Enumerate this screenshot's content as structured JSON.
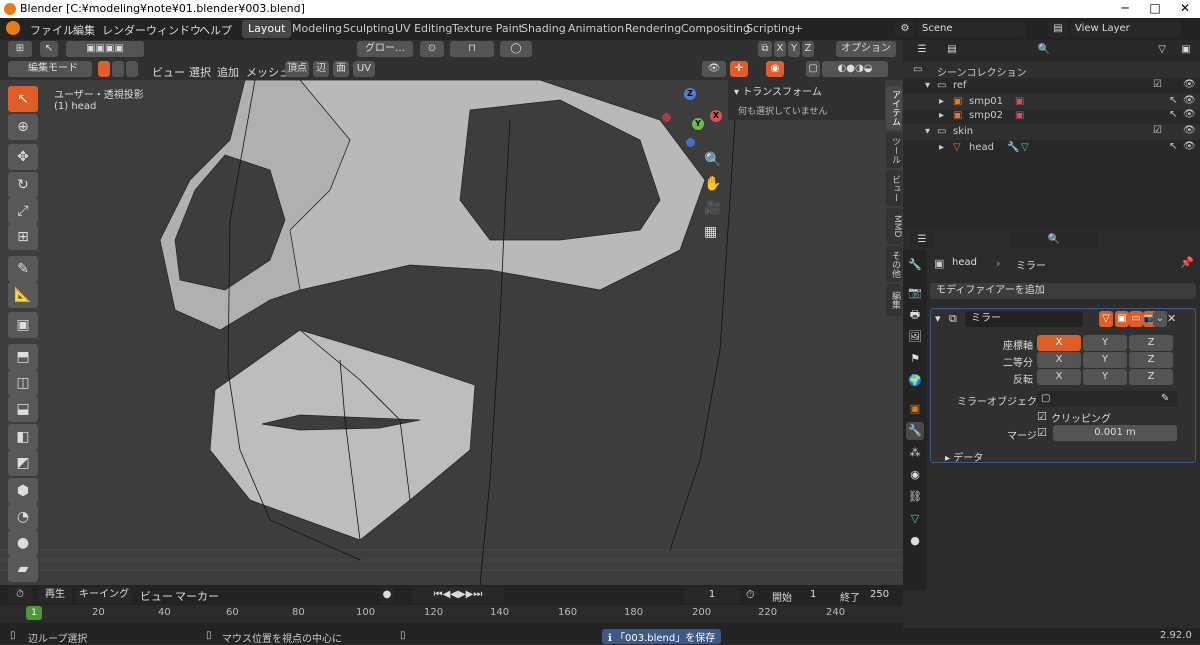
{
  "window": {
    "title": "Blender [C:¥modeling¥note¥01.blender¥003.blend]",
    "min": "─",
    "max": "□",
    "close": "✕"
  },
  "menu": [
    "ファイル",
    "編集",
    "レンダー",
    "ウィンドウ",
    "ヘルプ"
  ],
  "workspaces": [
    "Layout",
    "Modeling",
    "Sculpting",
    "UV Editing",
    "Texture Paint",
    "Shading",
    "Animation",
    "Rendering",
    "Compositing",
    "Scripting"
  ],
  "add_ws": "+",
  "scene": {
    "name": "Scene",
    "view_layer": "View Layer"
  },
  "vp_header": {
    "transform": "グロー…",
    "options": "オプション"
  },
  "xyz": [
    "X",
    "Y",
    "Z"
  ],
  "mode": {
    "label": "編集モード",
    "menus": [
      "ビュー",
      "選択",
      "追加",
      "メッシュ",
      "頂点",
      "辺",
      "面",
      "UV"
    ]
  },
  "viewport": {
    "view_label": "ユーザー・透視投影",
    "object_label": "(1) head",
    "transform_panel": "トランスフォーム",
    "nothing_selected": "何も選択していません"
  },
  "side_tabs": [
    "アイテム",
    "ツール",
    "ビュー",
    "MMD",
    "その他",
    "編集"
  ],
  "outliner": {
    "scene_collection": "シーンコレクション",
    "rows": [
      {
        "name": "ref",
        "level": 1
      },
      {
        "name": "smp01",
        "level": 2
      },
      {
        "name": "smp02",
        "level": 2
      },
      {
        "name": "skin",
        "level": 1
      },
      {
        "name": "head",
        "level": 2
      }
    ]
  },
  "properties": {
    "object": "head",
    "modifier_crumb": "ミラー",
    "add_modifier": "モディファイアーを追加",
    "mod_name": "ミラー",
    "axis_label": "座標軸",
    "bisect_label": "二等分",
    "flip_label": "反転",
    "mirror_object": "ミラーオブジェクト",
    "clipping": "クリッピング",
    "merge": "マージ",
    "merge_value": "0.001 m",
    "data": "データ"
  },
  "timeline": {
    "playback": "再生",
    "keying": "キーイング",
    "view": "ビュー",
    "marker": "マーカー",
    "current": "1",
    "start_label": "開始",
    "start": "1",
    "end_label": "終了",
    "end": "250",
    "ticks": [
      "1",
      "20",
      "40",
      "60",
      "80",
      "100",
      "120",
      "140",
      "160",
      "180",
      "200",
      "220",
      "240"
    ]
  },
  "status": {
    "left": "辺ループ選択",
    "middle": "マウス位置を視点の中心に",
    "saved": "「003.blend」を保存",
    "version": "2.92.0"
  },
  "colors": {
    "accent": "#e05d27",
    "bg": "#3d3d3d"
  }
}
